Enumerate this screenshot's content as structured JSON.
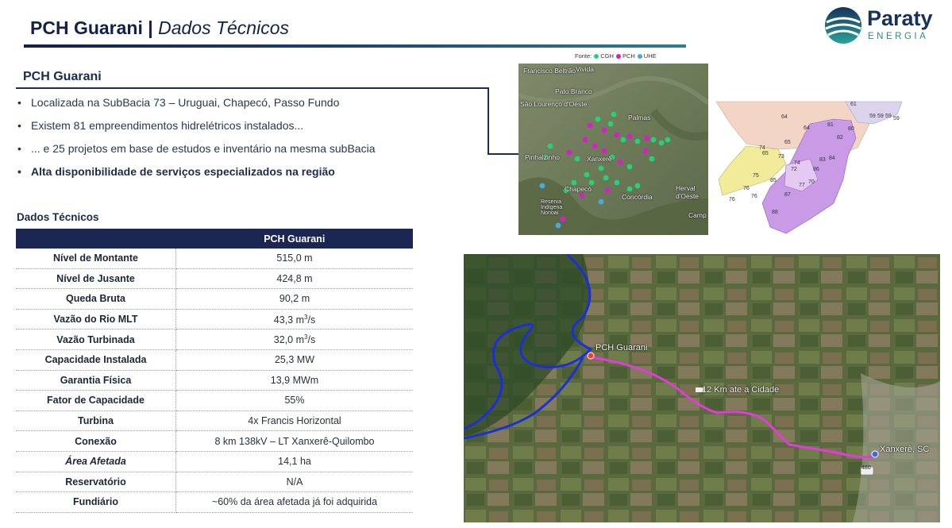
{
  "header": {
    "title_bold": "PCH Guarani |",
    "title_italic": "Dados Técnicos",
    "logo_word": "Paraty",
    "logo_sub": "ENERGIA"
  },
  "section": {
    "title": "PCH Guarani",
    "bullets": [
      "Localizada na SubBacia 73 – Uruguai, Chapecó, Passo Fundo",
      "Existem 81 empreendimentos hidrelétricos instalados...",
      "... e 25 projetos em base de estudos e inventário na mesma subBacia",
      "Alta disponibilidade de serviços especializados na região"
    ]
  },
  "table": {
    "title": "Dados Técnicos",
    "header": "PCH Guarani",
    "rows": [
      {
        "label": "Nível de Montante",
        "value": "515,0 m"
      },
      {
        "label": "Nível de Jusante",
        "value": "424,8 m"
      },
      {
        "label": "Queda Bruta",
        "value": "90,2 m"
      },
      {
        "label": "Vazão do Rio MLT",
        "value": "43,3 m",
        "sup": "3",
        "suffix": "/s"
      },
      {
        "label": "Vazão Turbinada",
        "value": "32,0 m",
        "sup": "3",
        "suffix": "/s"
      },
      {
        "label": "Capacidade Instalada",
        "value": "25,3 MW"
      },
      {
        "label": "Garantia Física",
        "value": "13,9 MWm"
      },
      {
        "label": "Fator de Capacidade",
        "value": "55%"
      },
      {
        "label": "Turbina",
        "value": "4x Francis Horizontal"
      },
      {
        "label": "Conexão",
        "value": "8 km 138kV – LT Xanxerê-Quilombo"
      },
      {
        "label": "Área Afetada",
        "value": "14,1 ha"
      },
      {
        "label": "Reservatório",
        "value": "N/A"
      },
      {
        "label": "Fundiário",
        "value": "~60% da área afetada já foi adquirida"
      }
    ]
  },
  "map1": {
    "legend_prefix": "Fonte:",
    "legend": [
      {
        "label": "CGH",
        "color": "#27d07a"
      },
      {
        "label": "PCH",
        "color": "#d61fc6"
      },
      {
        "label": "UHE",
        "color": "#4aa8e0"
      }
    ],
    "labels": [
      "Francisco Beltrão",
      "Vivida",
      "Pato Branco",
      "São Lourenço d'Oeste",
      "Palmas",
      "Pinhalzinho",
      "Xanxerê",
      "Chapecó",
      "Concórdia",
      "Herval d'Oeste",
      "Reserva Indígena Nonoai",
      "Camp"
    ]
  },
  "map2": {
    "labels": [
      "61",
      "64",
      "59",
      "59",
      "59",
      "59",
      "65",
      "64",
      "81",
      "82",
      "80",
      "74",
      "65",
      "73",
      "72",
      "84",
      "86",
      "87",
      "88",
      "75",
      "76",
      "85",
      "76",
      "70",
      "77",
      "83",
      "74",
      "76"
    ]
  },
  "map3": {
    "labels": [
      "PCH Guarani",
      "12 Km ate a Cidade",
      "Xanxerê, SC",
      "480"
    ]
  },
  "colors": {
    "navy": "#1b2652",
    "route": "#e23cd8",
    "river": "#1c2fd6"
  }
}
